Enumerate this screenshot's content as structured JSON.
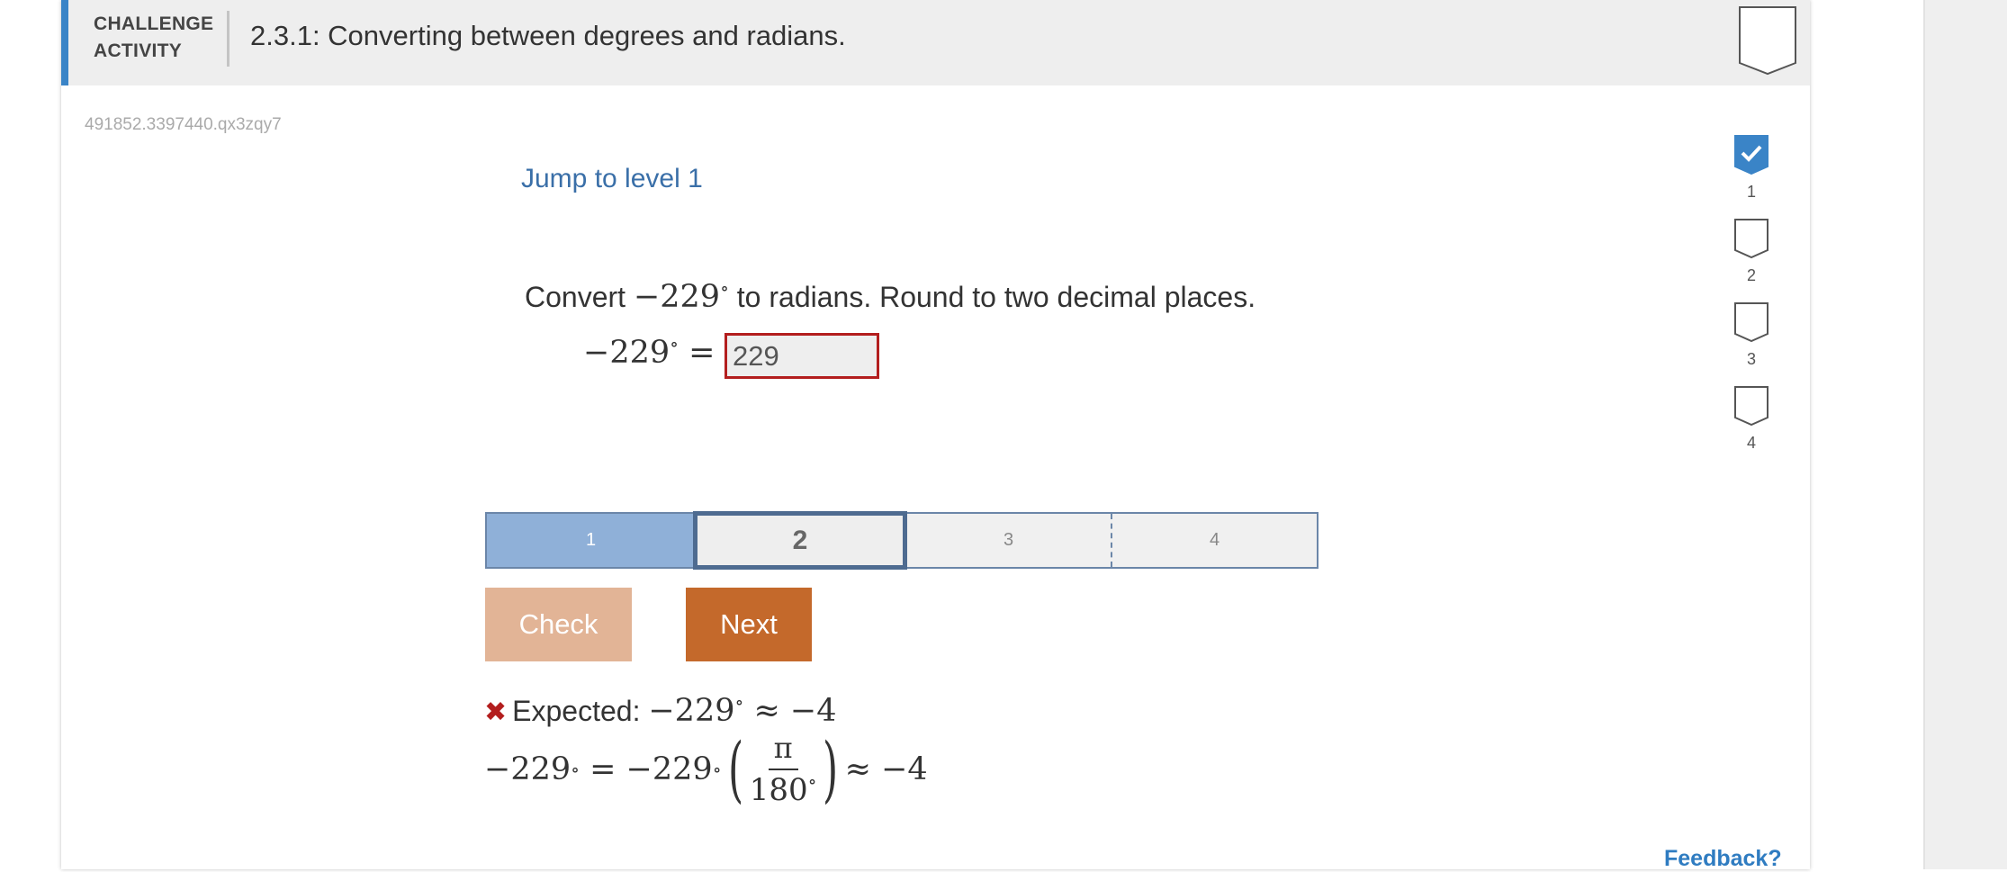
{
  "header": {
    "type_label": "CHALLENGE ACTIVITY",
    "title": "2.3.1: Converting between degrees and radians."
  },
  "activity_id": "491852.3397440.qx3zqy7",
  "jump_link": "Jump to level 1",
  "prompt": {
    "before": "Convert",
    "math": "−229",
    "degree": "∘",
    "after": "to radians. Round to two decimal places."
  },
  "equation": {
    "lhs": "−229",
    "degree": "∘",
    "equals": "="
  },
  "answer_input": {
    "value": "229"
  },
  "levels": [
    {
      "label": "1",
      "state": "completed"
    },
    {
      "label": "2",
      "state": "current"
    },
    {
      "label": "3",
      "state": "locked"
    },
    {
      "label": "4",
      "state": "locked"
    }
  ],
  "buttons": {
    "check": "Check",
    "next": "Next"
  },
  "feedback": {
    "expected_label": "Expected:",
    "expected_math": "−229",
    "degree": "∘",
    "approx_result": "≈ −4",
    "work_lhs": "−229",
    "work_eq": "= −229",
    "frac_num": "π",
    "frac_den": "180",
    "work_result": "≈ −4"
  },
  "sidebar_levels": [
    {
      "label": "1",
      "completed": true
    },
    {
      "label": "2",
      "completed": false
    },
    {
      "label": "3",
      "completed": false
    },
    {
      "label": "4",
      "completed": false
    }
  ],
  "feedback_link": "Feedback?",
  "colors": {
    "accent_blue": "#3a84c7",
    "error_red": "#b31e1e",
    "next_orange": "#c4692b",
    "check_disabled": "#e2b496",
    "level_done": "#8fb0d8"
  }
}
